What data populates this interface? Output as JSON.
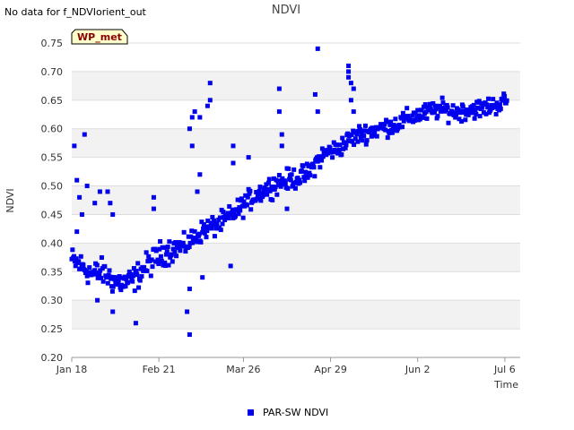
{
  "status_message": "No data for f_NDVIorient_out",
  "badge": "WP_met",
  "colors": {
    "series": "#0000ee",
    "band": "#f2f2f2",
    "badge_fill": "#ffffcc",
    "grid": "#dddddd"
  },
  "chart_data": {
    "type": "scatter",
    "title": "NDVI",
    "xlabel": "Time",
    "ylabel": "NDVI",
    "x_ticks": [
      "Jan 18",
      "Feb 21",
      "Mar 26",
      "Apr 29",
      "Jun 2",
      "Jul 6"
    ],
    "x_tick_days": [
      0,
      34,
      67,
      101,
      135,
      169
    ],
    "xlim_days": [
      0,
      175
    ],
    "ylim": [
      0.2,
      0.75
    ],
    "y_ticks": [
      "0.20",
      "0.25",
      "0.30",
      "0.35",
      "0.40",
      "0.45",
      "0.50",
      "0.55",
      "0.60",
      "0.65",
      "0.70",
      "0.75"
    ],
    "grid": true,
    "legend_position": "bottom-center",
    "series": [
      {
        "name": "PAR-SW NDVI",
        "trend": [
          [
            0,
            0.37
          ],
          [
            4,
            0.36
          ],
          [
            8,
            0.345
          ],
          [
            12,
            0.35
          ],
          [
            16,
            0.335
          ],
          [
            20,
            0.33
          ],
          [
            24,
            0.335
          ],
          [
            28,
            0.355
          ],
          [
            32,
            0.37
          ],
          [
            36,
            0.385
          ],
          [
            40,
            0.39
          ],
          [
            44,
            0.395
          ],
          [
            48,
            0.41
          ],
          [
            52,
            0.425
          ],
          [
            56,
            0.43
          ],
          [
            60,
            0.44
          ],
          [
            64,
            0.455
          ],
          [
            68,
            0.47
          ],
          [
            72,
            0.485
          ],
          [
            76,
            0.495
          ],
          [
            80,
            0.505
          ],
          [
            84,
            0.51
          ],
          [
            88,
            0.515
          ],
          [
            92,
            0.52
          ],
          [
            96,
            0.545
          ],
          [
            100,
            0.56
          ],
          [
            104,
            0.565
          ],
          [
            108,
            0.58
          ],
          [
            112,
            0.59
          ],
          [
            116,
            0.595
          ],
          [
            120,
            0.6
          ],
          [
            124,
            0.605
          ],
          [
            128,
            0.61
          ],
          [
            132,
            0.62
          ],
          [
            136,
            0.625
          ],
          [
            140,
            0.63
          ],
          [
            144,
            0.635
          ],
          [
            148,
            0.63
          ],
          [
            152,
            0.63
          ],
          [
            156,
            0.635
          ],
          [
            160,
            0.635
          ],
          [
            164,
            0.64
          ],
          [
            168,
            0.645
          ],
          [
            170,
            0.65
          ]
        ],
        "outliers": [
          [
            1,
            0.57
          ],
          [
            2,
            0.51
          ],
          [
            3,
            0.48
          ],
          [
            5,
            0.59
          ],
          [
            6,
            0.5
          ],
          [
            4,
            0.45
          ],
          [
            2,
            0.42
          ],
          [
            9,
            0.47
          ],
          [
            11,
            0.49
          ],
          [
            14,
            0.49
          ],
          [
            15,
            0.47
          ],
          [
            16,
            0.45
          ],
          [
            10,
            0.3
          ],
          [
            16,
            0.28
          ],
          [
            25,
            0.26
          ],
          [
            32,
            0.48
          ],
          [
            32,
            0.46
          ],
          [
            46,
            0.6
          ],
          [
            47,
            0.62
          ],
          [
            48,
            0.63
          ],
          [
            47,
            0.57
          ],
          [
            50,
            0.62
          ],
          [
            50,
            0.52
          ],
          [
            49,
            0.49
          ],
          [
            51,
            0.34
          ],
          [
            46,
            0.32
          ],
          [
            45,
            0.28
          ],
          [
            46,
            0.24
          ],
          [
            53,
            0.64
          ],
          [
            54,
            0.65
          ],
          [
            54,
            0.68
          ],
          [
            63,
            0.57
          ],
          [
            63,
            0.54
          ],
          [
            62,
            0.36
          ],
          [
            69,
            0.55
          ],
          [
            81,
            0.67
          ],
          [
            81,
            0.63
          ],
          [
            82,
            0.59
          ],
          [
            82,
            0.57
          ],
          [
            84,
            0.46
          ],
          [
            96,
            0.74
          ],
          [
            95,
            0.66
          ],
          [
            96,
            0.63
          ],
          [
            108,
            0.71
          ],
          [
            108,
            0.7
          ],
          [
            108,
            0.69
          ],
          [
            109,
            0.68
          ],
          [
            110,
            0.67
          ],
          [
            109,
            0.65
          ],
          [
            110,
            0.63
          ]
        ]
      }
    ]
  }
}
